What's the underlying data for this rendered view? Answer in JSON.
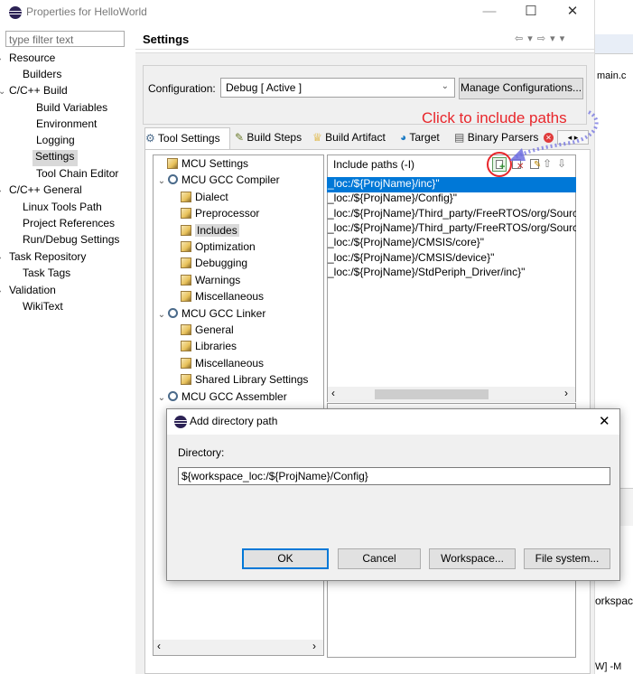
{
  "window": {
    "title": "Properties for HelloWorld",
    "min": "—",
    "max": "☐",
    "close": "✕"
  },
  "left": {
    "filter_placeholder": "type filter text",
    "items": [
      {
        "label": "Resource",
        "arrow": "›"
      },
      {
        "label": "Builders",
        "arrow": ""
      },
      {
        "label": "C/C++ Build",
        "arrow": "⌄"
      },
      {
        "label": "Build Variables",
        "arrow": ""
      },
      {
        "label": "Environment",
        "arrow": ""
      },
      {
        "label": "Logging",
        "arrow": ""
      },
      {
        "label": "Settings",
        "arrow": ""
      },
      {
        "label": "Tool Chain Editor",
        "arrow": ""
      },
      {
        "label": "C/C++ General",
        "arrow": "›"
      },
      {
        "label": "Linux Tools Path",
        "arrow": ""
      },
      {
        "label": "Project References",
        "arrow": ""
      },
      {
        "label": "Run/Debug Settings",
        "arrow": ""
      },
      {
        "label": "Task Repository",
        "arrow": "›"
      },
      {
        "label": "Task Tags",
        "arrow": ""
      },
      {
        "label": "Validation",
        "arrow": "›"
      },
      {
        "label": "WikiText",
        "arrow": ""
      }
    ]
  },
  "settings": {
    "title": "Settings",
    "nav": "⇦ ▾ ⇨ ▾ ▾",
    "config_label": "Configuration:",
    "config_value": "Debug  [ Active ]",
    "manage_button": "Manage Configurations...",
    "tabs": [
      "Tool Settings",
      "Build Steps",
      "Build Artifact",
      "Target",
      "Binary Parsers"
    ]
  },
  "tool_tree": [
    {
      "label": "MCU Settings",
      "arrow": "",
      "icon": "page"
    },
    {
      "label": "MCU GCC Compiler",
      "arrow": "⌄",
      "icon": "gear"
    },
    {
      "label": "Dialect",
      "arrow": "",
      "icon": "page"
    },
    {
      "label": "Preprocessor",
      "arrow": "",
      "icon": "page"
    },
    {
      "label": "Includes",
      "arrow": "",
      "icon": "page"
    },
    {
      "label": "Optimization",
      "arrow": "",
      "icon": "page"
    },
    {
      "label": "Debugging",
      "arrow": "",
      "icon": "page"
    },
    {
      "label": "Warnings",
      "arrow": "",
      "icon": "page"
    },
    {
      "label": "Miscellaneous",
      "arrow": "",
      "icon": "page"
    },
    {
      "label": "MCU GCC Linker",
      "arrow": "⌄",
      "icon": "gear"
    },
    {
      "label": "General",
      "arrow": "",
      "icon": "page"
    },
    {
      "label": "Libraries",
      "arrow": "",
      "icon": "page"
    },
    {
      "label": "Miscellaneous",
      "arrow": "",
      "icon": "page"
    },
    {
      "label": "Shared Library Settings",
      "arrow": "",
      "icon": "page"
    },
    {
      "label": "MCU GCC Assembler",
      "arrow": "⌄",
      "icon": "gear"
    }
  ],
  "includes": {
    "header": "Include paths (-I)",
    "paths": [
      "_loc:/${ProjName}/inc}\"",
      "_loc:/${ProjName}/Config}\"",
      "_loc:/${ProjName}/Third_party/FreeRTOS/org/Sourc",
      "_loc:/${ProjName}/Third_party/FreeRTOS/org/Sourc",
      "_loc:/${ProjName}/CMSIS/core}\"",
      "_loc:/${ProjName}/CMSIS/device}\"",
      "_loc:/${ProjName}/StdPeriph_Driver/inc}\""
    ]
  },
  "annotation": "Click to include paths",
  "background_right": {
    "tab": "main.c",
    "text1": "orkspac",
    "text2": "W] -M"
  },
  "dialog": {
    "title": "Add directory path",
    "close": "✕",
    "directory_label": "Directory:",
    "directory_value": "${workspace_loc:/${ProjName}/Config}",
    "ok": "OK",
    "cancel": "Cancel",
    "workspace": "Workspace...",
    "filesystem": "File system..."
  },
  "scroll": {
    "left": "‹",
    "right": "›"
  },
  "colors": {
    "accent": "#0078d7",
    "annotation": "#e8262b"
  }
}
